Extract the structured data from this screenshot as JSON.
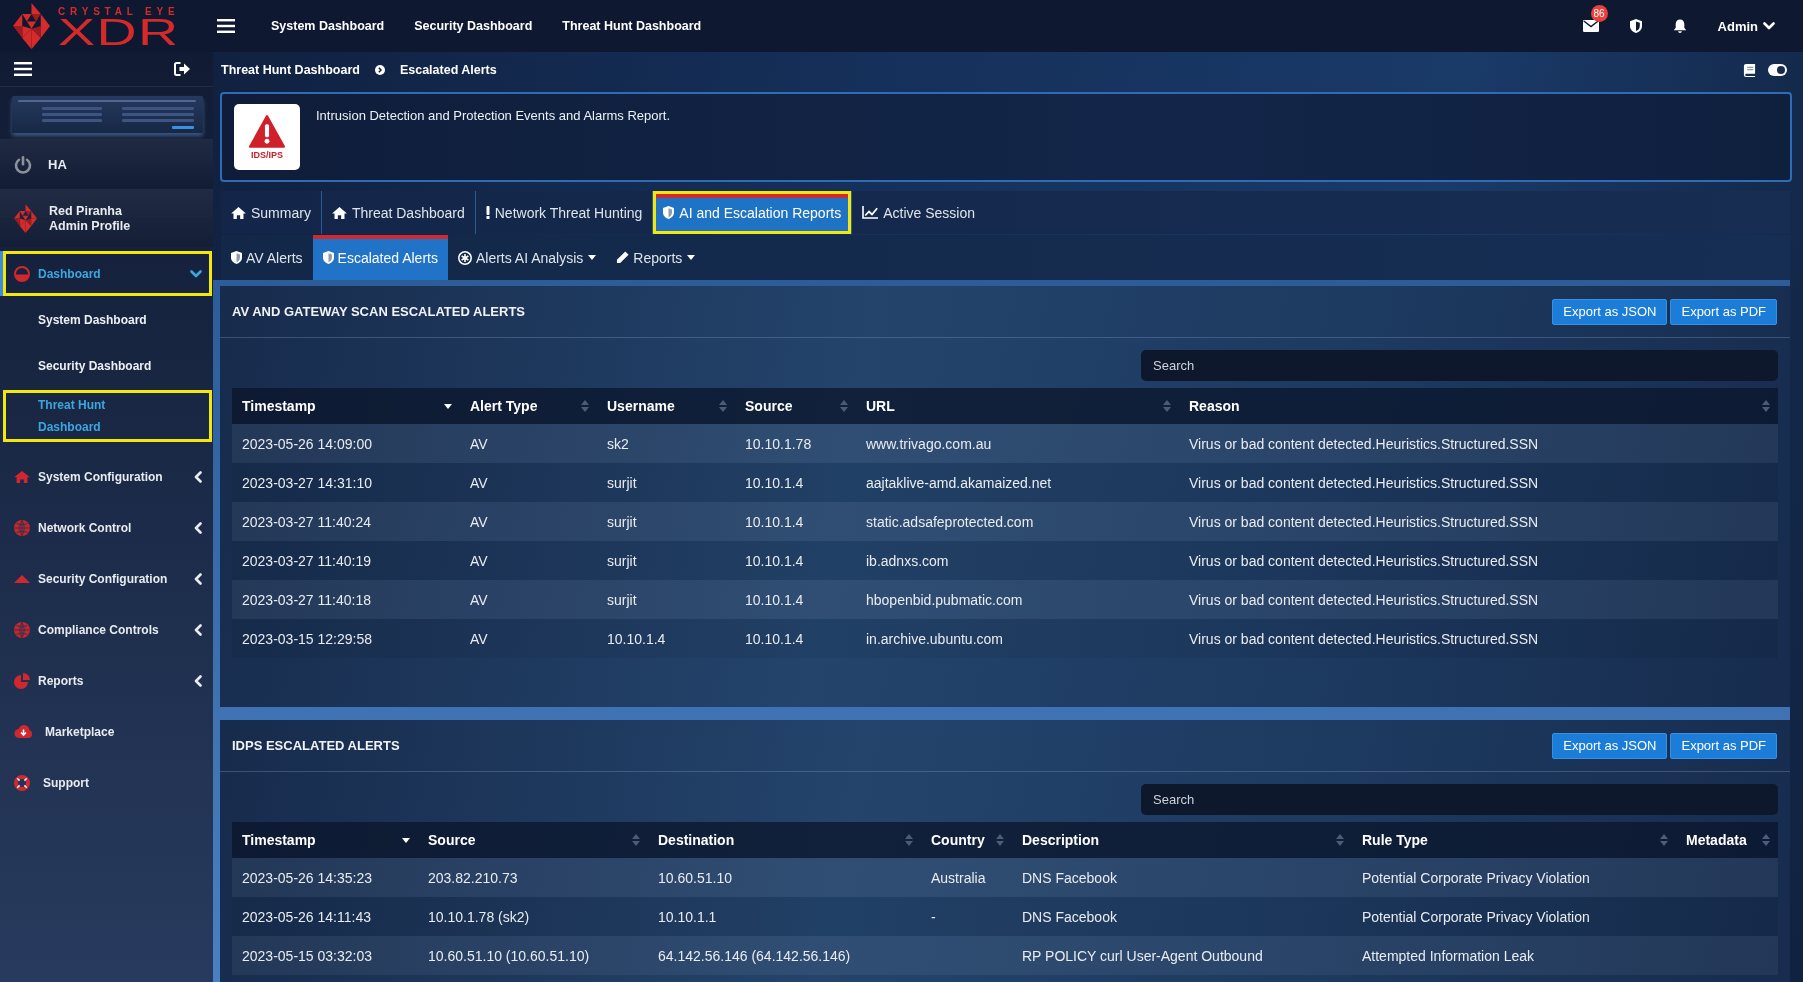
{
  "logo": {
    "brand": "CRYSTAL EYE",
    "product": "XDR"
  },
  "top_nav": {
    "links": [
      "System Dashboard",
      "Security Dashboard",
      "Threat Hunt Dashboard"
    ],
    "mail_count": "86",
    "user": "Admin"
  },
  "sidebar": {
    "ha": "HA",
    "profile": {
      "name": "Red Piranha",
      "role": "Admin Profile"
    },
    "items": [
      {
        "label": "Dashboard",
        "kind": "group",
        "expanded": true,
        "selected": true,
        "highlighted": true,
        "children": [
          {
            "label": "System Dashboard",
            "selected": false,
            "highlighted": false
          },
          {
            "label": "Security Dashboard",
            "selected": false,
            "highlighted": false
          },
          {
            "label": "Threat Hunt Dashboard",
            "selected": true,
            "highlighted": true
          }
        ]
      },
      {
        "label": "System Configuration",
        "kind": "group",
        "expanded": false,
        "selected": false,
        "highlighted": false
      },
      {
        "label": "Network Control",
        "kind": "group",
        "expanded": false,
        "selected": false,
        "highlighted": false
      },
      {
        "label": "Security Configuration",
        "kind": "group",
        "expanded": false,
        "selected": false,
        "highlighted": false
      },
      {
        "label": "Compliance Controls",
        "kind": "group",
        "expanded": false,
        "selected": false,
        "highlighted": false
      },
      {
        "label": "Reports",
        "kind": "group",
        "expanded": false,
        "selected": false,
        "highlighted": false
      },
      {
        "label": "Marketplace",
        "kind": "link",
        "selected": false,
        "highlighted": false
      },
      {
        "label": "Support",
        "kind": "link",
        "selected": false,
        "highlighted": false
      }
    ]
  },
  "breadcrumb": {
    "items": [
      "Threat Hunt Dashboard",
      "Escalated Alerts"
    ],
    "toggle_on": true
  },
  "info_card": {
    "badge": "IDS/IPS",
    "text": "Intrusion Detection and Protection Events and Alarms Report."
  },
  "tabs": [
    {
      "label": "Summary",
      "selected": false,
      "highlighted": false
    },
    {
      "label": "Threat Dashboard",
      "selected": false,
      "highlighted": false
    },
    {
      "label": "Network Threat Hunting",
      "selected": false,
      "highlighted": false
    },
    {
      "label": "AI and Escalation Reports",
      "selected": true,
      "highlighted": true
    },
    {
      "label": "Active Session",
      "selected": false,
      "highlighted": false
    }
  ],
  "sub_tabs": [
    {
      "label": "AV Alerts",
      "selected": false,
      "has_menu": false
    },
    {
      "label": "Escalated Alerts",
      "selected": true,
      "has_menu": false
    },
    {
      "label": "Alerts AI Analysis",
      "selected": false,
      "has_menu": true
    },
    {
      "label": "Reports",
      "selected": false,
      "has_menu": true
    }
  ],
  "panels": [
    {
      "title": "AV AND GATEWAY SCAN ESCALATED ALERTS",
      "buttons": [
        "Export as JSON",
        "Export as PDF"
      ],
      "search": {
        "placeholder": "Search"
      },
      "table": {
        "columns": [
          {
            "label": "Timestamp",
            "sorted": true
          },
          {
            "label": "Alert Type",
            "sorted": false
          },
          {
            "label": "Username",
            "sorted": false
          },
          {
            "label": "Source",
            "sorted": false
          },
          {
            "label": "URL",
            "sorted": false
          },
          {
            "label": "Reason",
            "sorted": false
          }
        ],
        "rows": [
          [
            "2023-05-26 14:09:00",
            "AV",
            "sk2",
            "10.10.1.78",
            "www.trivago.com.au",
            "Virus or bad content detected.Heuristics.Structured.SSN"
          ],
          [
            "2023-03-27 14:31:10",
            "AV",
            "surjit",
            "10.10.1.4",
            "aajtaklive-amd.akamaized.net",
            "Virus or bad content detected.Heuristics.Structured.SSN"
          ],
          [
            "2023-03-27 11:40:24",
            "AV",
            "surjit",
            "10.10.1.4",
            "static.adsafeprotected.com",
            "Virus or bad content detected.Heuristics.Structured.SSN"
          ],
          [
            "2023-03-27 11:40:19",
            "AV",
            "surjit",
            "10.10.1.4",
            "ib.adnxs.com",
            "Virus or bad content detected.Heuristics.Structured.SSN"
          ],
          [
            "2023-03-27 11:40:18",
            "AV",
            "surjit",
            "10.10.1.4",
            "hbopenbid.pubmatic.com",
            "Virus or bad content detected.Heuristics.Structured.SSN"
          ],
          [
            "2023-03-15 12:29:58",
            "AV",
            "10.10.1.4",
            "10.10.1.4",
            "in.archive.ubuntu.com",
            "Virus or bad content detected.Heuristics.Structured.SSN"
          ]
        ]
      }
    },
    {
      "title": "IDPS ESCALATED ALERTS",
      "buttons": [
        "Export as JSON",
        "Export as PDF"
      ],
      "search": {
        "placeholder": "Search"
      },
      "table": {
        "columns": [
          {
            "label": "Timestamp",
            "sorted": true
          },
          {
            "label": "Source",
            "sorted": false
          },
          {
            "label": "Destination",
            "sorted": false
          },
          {
            "label": "Country",
            "sorted": false
          },
          {
            "label": "Description",
            "sorted": false
          },
          {
            "label": "Rule Type",
            "sorted": false
          },
          {
            "label": "Metadata",
            "sorted": false
          }
        ],
        "rows": [
          [
            "2023-05-26 14:35:23",
            "203.82.210.73",
            "10.60.51.10",
            "Australia",
            "DNS Facebook",
            "Potential Corporate Privacy Violation",
            null
          ],
          [
            "2023-05-26 14:11:43",
            "10.10.1.78 (sk2)",
            "10.10.1.1",
            "-",
            "DNS Facebook",
            "Potential Corporate Privacy Violation",
            null
          ],
          [
            "2023-05-15 03:32:03",
            "10.60.51.10 (10.60.51.10)",
            "64.142.56.146 (64.142.56.146)",
            null,
            "RP POLICY curl User-Agent Outbound",
            "Attempted Information Leak",
            null
          ]
        ]
      }
    }
  ]
}
